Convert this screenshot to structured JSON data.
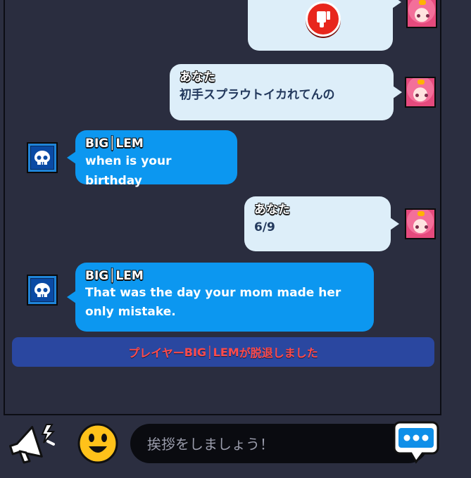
{
  "messages": [
    {
      "sender": "",
      "text": "",
      "side": "me",
      "kind": "thumbs-down"
    },
    {
      "sender": "あなた",
      "text": "初手スプラウトイカれてんの",
      "side": "me"
    },
    {
      "sender": "BIG│LEM",
      "text": "when is your birthday",
      "side": "other"
    },
    {
      "sender": "あなた",
      "text": "6/9",
      "side": "me"
    },
    {
      "sender": "BIG│LEM",
      "text": "That was the day your mom made her only mistake.",
      "side": "other"
    }
  ],
  "system_message": {
    "prefix": "プレイヤー",
    "name": "BIG│LEM",
    "suffix": "が脱退しました"
  },
  "input": {
    "placeholder": "挨拶をしましょう！",
    "value": ""
  },
  "icons": {
    "megaphone": "megaphone-icon",
    "emoji": "emoji-icon",
    "send": "chat-bubble-icon",
    "thumbs_down": "thumbs-down-icon",
    "skull": "skull-icon"
  },
  "colors": {
    "my_bubble": "#ddeef9",
    "other_bubble": "#0c97f0",
    "system_bar": "#2a47a0",
    "system_text": "#ff4b4b",
    "background": "#2a2d3f"
  }
}
